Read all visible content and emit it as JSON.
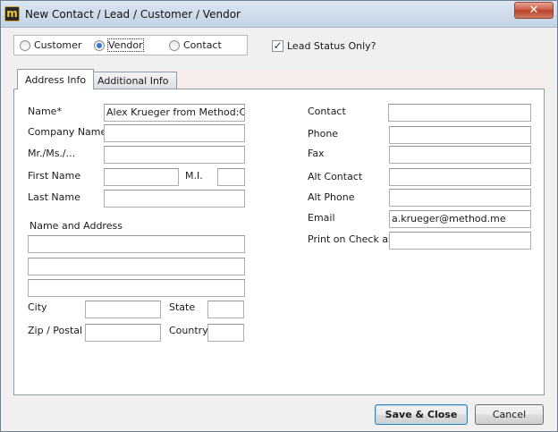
{
  "window": {
    "title": "New Contact / Lead / Customer / Vendor",
    "app_icon_letter": "m",
    "close_glyph": "✕"
  },
  "record_type": {
    "options": [
      {
        "label": "Customer",
        "checked": false
      },
      {
        "label": "Vendor",
        "checked": true
      },
      {
        "label": "Contact",
        "checked": false
      }
    ]
  },
  "lead_status": {
    "label": "Lead Status Only?",
    "checked": true,
    "check_glyph": "✓"
  },
  "tabs": [
    {
      "label": "Address Info",
      "active": true
    },
    {
      "label": "Additional Info",
      "active": false
    }
  ],
  "left_fields": {
    "name": {
      "label": "Name*",
      "value": "Alex Krueger from Method:CRM"
    },
    "company": {
      "label": "Company Name",
      "value": ""
    },
    "salutation": {
      "label": "Mr./Ms./...",
      "value": ""
    },
    "first_name": {
      "label": "First Name",
      "value": ""
    },
    "mi": {
      "label": "M.I.",
      "value": ""
    },
    "last_name": {
      "label": "Last Name",
      "value": ""
    },
    "address_heading": "Name and Address",
    "address_lines": [
      "",
      "",
      ""
    ],
    "city": {
      "label": "City",
      "value": ""
    },
    "state": {
      "label": "State",
      "value": ""
    },
    "zip": {
      "label": "Zip / Postal",
      "value": ""
    },
    "country": {
      "label": "Country",
      "value": ""
    }
  },
  "right_fields": {
    "contact": {
      "label": "Contact",
      "value": ""
    },
    "phone": {
      "label": "Phone",
      "value": ""
    },
    "fax": {
      "label": "Fax",
      "value": ""
    },
    "alt_contact": {
      "label": "Alt Contact",
      "value": ""
    },
    "alt_phone": {
      "label": "Alt Phone",
      "value": ""
    },
    "email": {
      "label": "Email",
      "value": "a.krueger@method.me"
    },
    "print_on_check": {
      "label": "Print on Check as",
      "value": ""
    }
  },
  "buttons": {
    "save_close": "Save & Close",
    "cancel": "Cancel"
  }
}
